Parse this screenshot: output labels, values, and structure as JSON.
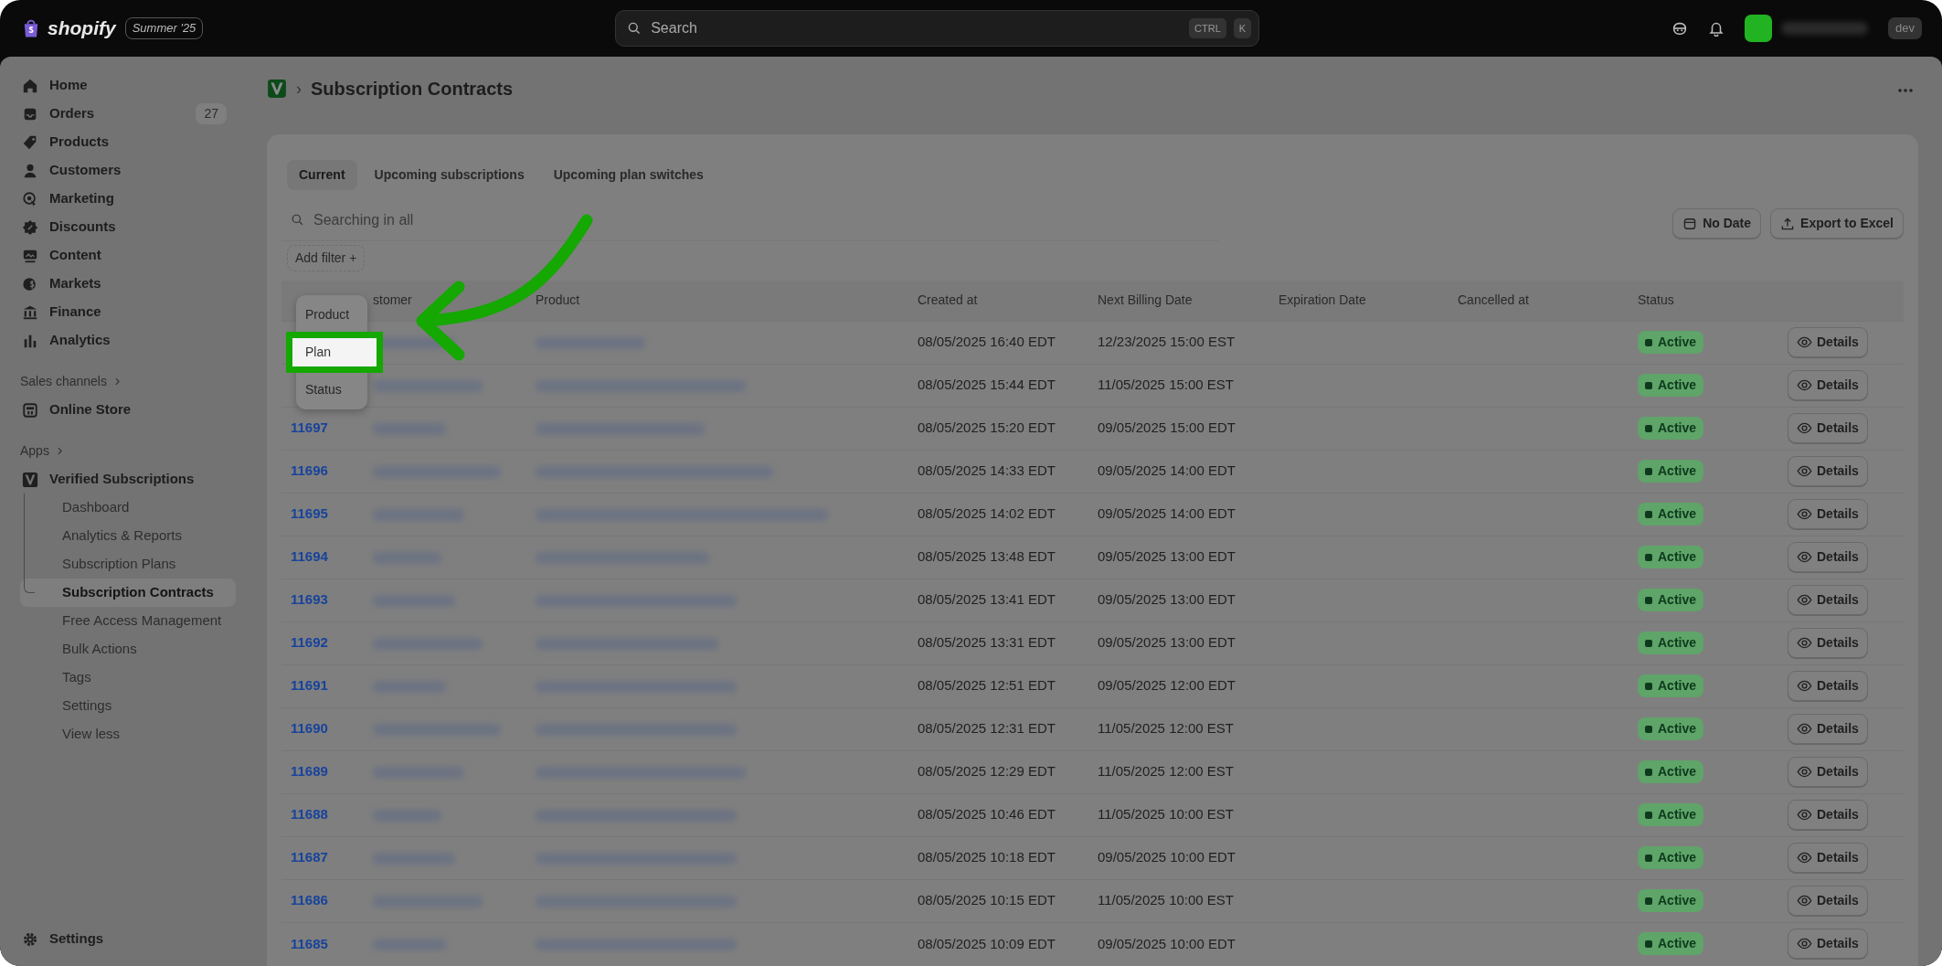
{
  "topbar": {
    "logo": "shopify",
    "edition": "Summer '25",
    "search": {
      "placeholder": "Search",
      "shortcut": [
        "CTRL",
        "K"
      ]
    },
    "store_tag": "dev"
  },
  "sidebar": {
    "items": [
      {
        "label": "Home"
      },
      {
        "label": "Orders",
        "count": "27"
      },
      {
        "label": "Products"
      },
      {
        "label": "Customers"
      },
      {
        "label": "Marketing"
      },
      {
        "label": "Discounts"
      },
      {
        "label": "Content"
      },
      {
        "label": "Markets"
      },
      {
        "label": "Finance"
      },
      {
        "label": "Analytics"
      }
    ],
    "sales_channels": {
      "heading": "Sales channels",
      "items": [
        {
          "label": "Online Store"
        }
      ]
    },
    "apps": {
      "heading": "Apps",
      "app": {
        "label": "Verified Subscriptions",
        "children": [
          {
            "label": "Dashboard",
            "selected": false
          },
          {
            "label": "Analytics & Reports",
            "selected": false
          },
          {
            "label": "Subscription Plans",
            "selected": false
          },
          {
            "label": "Subscription Contracts",
            "selected": true
          },
          {
            "label": "Free Access Management",
            "selected": false
          },
          {
            "label": "Bulk Actions",
            "selected": false
          },
          {
            "label": "Tags",
            "selected": false
          },
          {
            "label": "Settings",
            "selected": false
          },
          {
            "label": "View less",
            "selected": false
          }
        ]
      }
    },
    "footer": {
      "label": "Settings"
    }
  },
  "page": {
    "breadcrumb": "›",
    "title": "Subscription Contracts",
    "tabs": [
      {
        "label": "Current",
        "selected": true
      },
      {
        "label": "Upcoming subscriptions",
        "selected": false
      },
      {
        "label": "Upcoming plan switches",
        "selected": false
      }
    ],
    "search": {
      "placeholder": "Searching in all"
    },
    "buttons": [
      {
        "kind": "date",
        "label": "No Date"
      },
      {
        "kind": "export",
        "label": "Export to Excel"
      }
    ],
    "add_filter": {
      "label": "Add filter",
      "icon": "+"
    },
    "filter_menu": [
      {
        "label": "Product",
        "selected": false
      },
      {
        "label": "Plan",
        "selected": true
      },
      {
        "label": "Status",
        "selected": false
      }
    ],
    "table": {
      "columns": [
        {
          "label": "stomer"
        },
        {
          "label": "Product"
        },
        {
          "label": "Created at"
        },
        {
          "label": "Next Billing Date"
        },
        {
          "label": "Expiration Date"
        },
        {
          "label": "Cancelled at"
        },
        {
          "label": "Status"
        }
      ],
      "rows": [
        {
          "created": "08/05/2025 16:40 EDT",
          "next_billing": "12/23/2025 15:00 EST",
          "status": "Active",
          "action": "Details"
        },
        {
          "created": "08/05/2025 15:44 EDT",
          "next_billing": "11/05/2025 15:00 EST",
          "status": "Active",
          "action": "Details"
        },
        {
          "id": "11697",
          "created": "08/05/2025 15:20 EDT",
          "next_billing": "09/05/2025 15:00 EDT",
          "status": "Active",
          "action": "Details"
        },
        {
          "id": "11696",
          "created": "08/05/2025 14:33 EDT",
          "next_billing": "09/05/2025 14:00 EDT",
          "status": "Active",
          "action": "Details"
        },
        {
          "id": "11695",
          "created": "08/05/2025 14:02 EDT",
          "next_billing": "09/05/2025 14:00 EDT",
          "status": "Active",
          "action": "Details"
        },
        {
          "id": "11694",
          "created": "08/05/2025 13:48 EDT",
          "next_billing": "09/05/2025 13:00 EDT",
          "status": "Active",
          "action": "Details"
        },
        {
          "id": "11693",
          "created": "08/05/2025 13:41 EDT",
          "next_billing": "09/05/2025 13:00 EDT",
          "status": "Active",
          "action": "Details"
        },
        {
          "id": "11692",
          "created": "08/05/2025 13:31 EDT",
          "next_billing": "09/05/2025 13:00 EDT",
          "status": "Active",
          "action": "Details"
        },
        {
          "id": "11691",
          "created": "08/05/2025 12:51 EDT",
          "next_billing": "09/05/2025 12:00 EDT",
          "status": "Active",
          "action": "Details"
        },
        {
          "id": "11690",
          "created": "08/05/2025 12:31 EDT",
          "next_billing": "11/05/2025 12:00 EST",
          "status": "Active",
          "action": "Details"
        },
        {
          "id": "11689",
          "created": "08/05/2025 12:29 EDT",
          "next_billing": "11/05/2025 12:00 EST",
          "status": "Active",
          "action": "Details"
        },
        {
          "id": "11688",
          "created": "08/05/2025 10:46 EDT",
          "next_billing": "11/05/2025 10:00 EST",
          "status": "Active",
          "action": "Details"
        },
        {
          "id": "11687",
          "created": "08/05/2025 10:18 EDT",
          "next_billing": "09/05/2025 10:00 EDT",
          "status": "Active",
          "action": "Details"
        },
        {
          "id": "11686",
          "created": "08/05/2025 10:15 EDT",
          "next_billing": "11/05/2025 10:00 EST",
          "status": "Active",
          "action": "Details"
        },
        {
          "id": "11685",
          "created": "08/05/2025 10:09 EDT",
          "next_billing": "09/05/2025 10:00 EDT",
          "status": "Active",
          "action": "Details"
        }
      ]
    }
  }
}
